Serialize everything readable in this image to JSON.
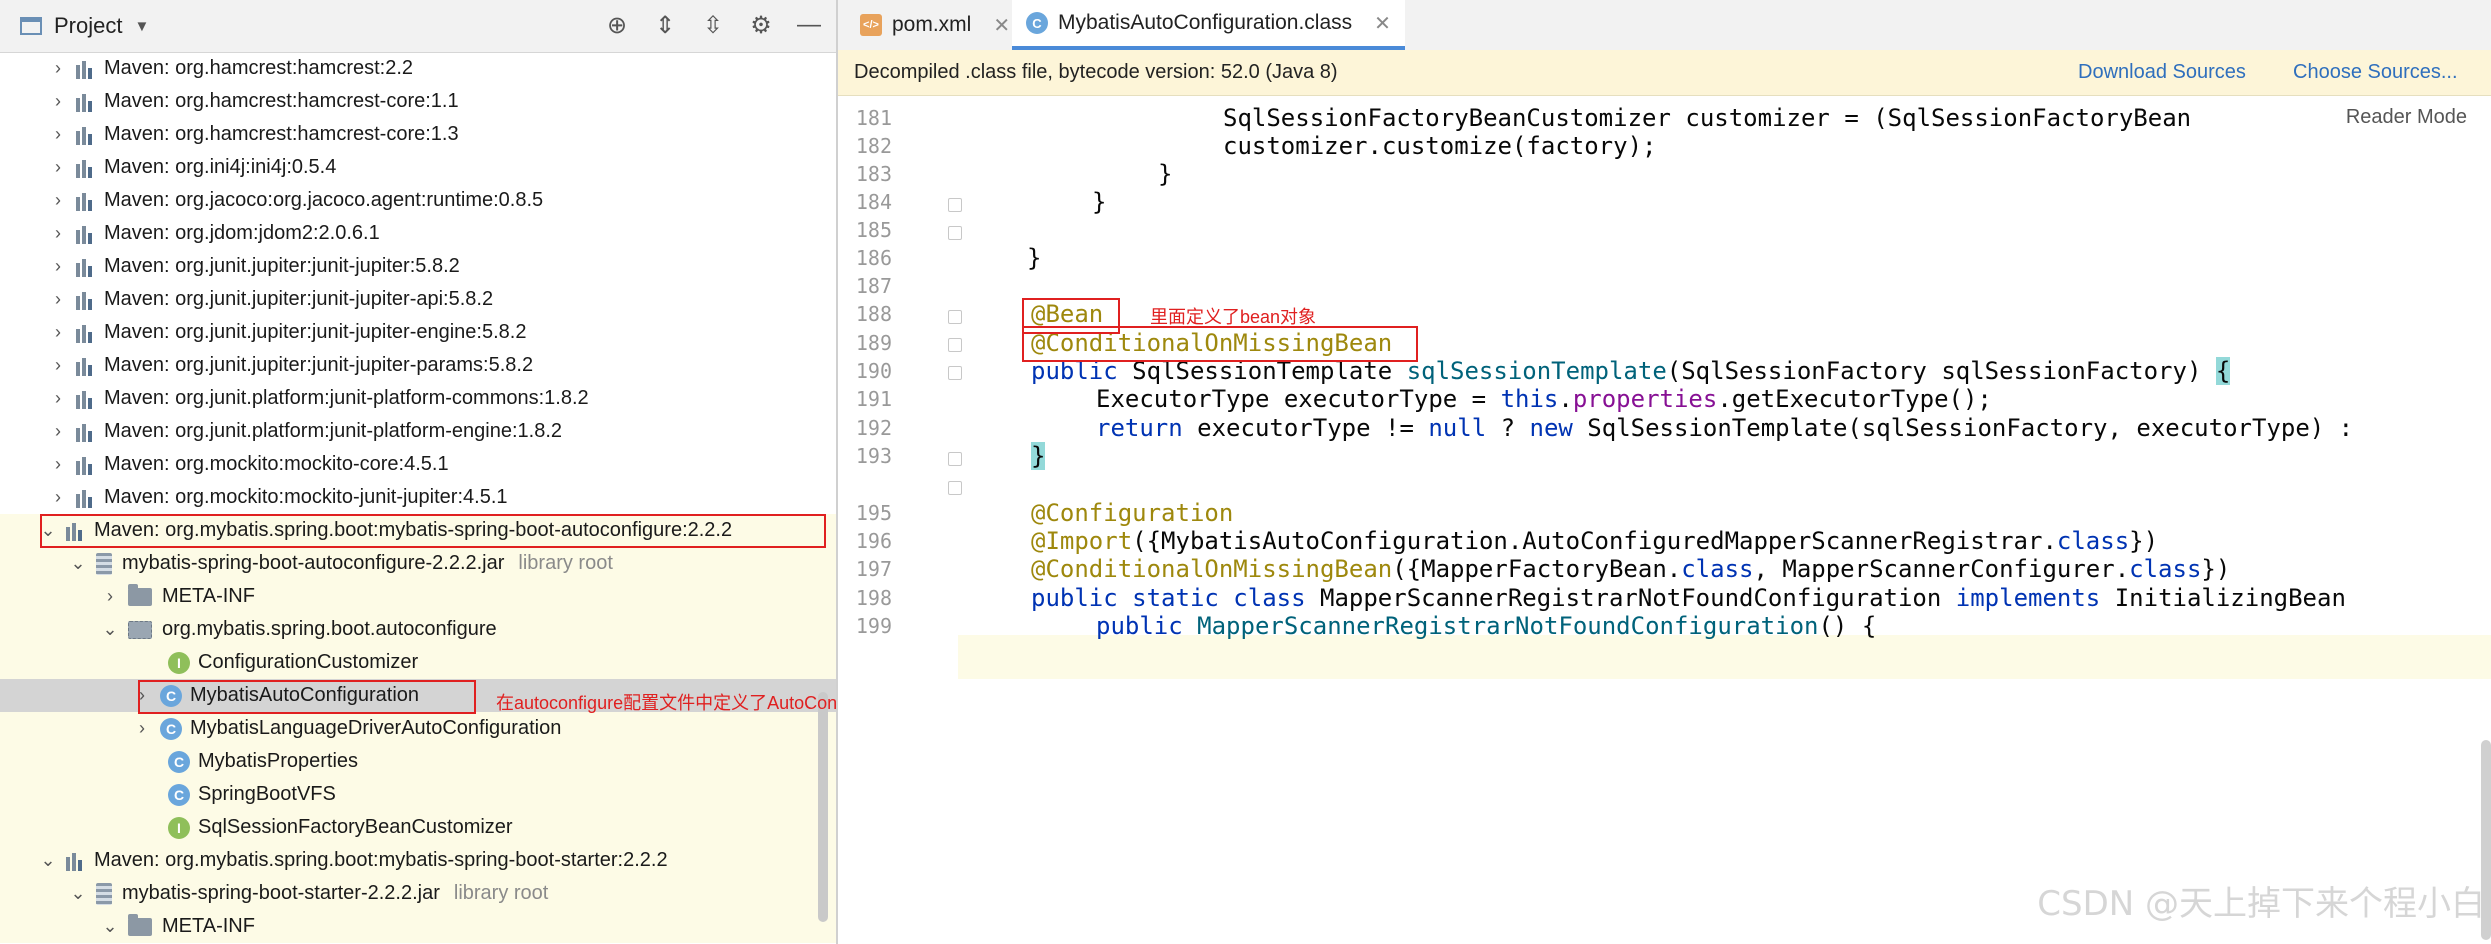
{
  "project": {
    "title": "Project",
    "tree": [
      {
        "label": "Maven: org.hamcrest:hamcrest:2.2"
      },
      {
        "label": "Maven: org.hamcrest:hamcrest-core:1.1"
      },
      {
        "label": "Maven: org.hamcrest:hamcrest-core:1.3"
      },
      {
        "label": "Maven: org.ini4j:ini4j:0.5.4"
      },
      {
        "label": "Maven: org.jacoco:org.jacoco.agent:runtime:0.8.5"
      },
      {
        "label": "Maven: org.jdom:jdom2:2.0.6.1"
      },
      {
        "label": "Maven: org.junit.jupiter:junit-jupiter:5.8.2"
      },
      {
        "label": "Maven: org.junit.jupiter:junit-jupiter-api:5.8.2"
      },
      {
        "label": "Maven: org.junit.jupiter:junit-jupiter-engine:5.8.2"
      },
      {
        "label": "Maven: org.junit.jupiter:junit-jupiter-params:5.8.2"
      },
      {
        "label": "Maven: org.junit.platform:junit-platform-commons:1.8.2"
      },
      {
        "label": "Maven: org.junit.platform:junit-platform-engine:1.8.2"
      },
      {
        "label": "Maven: org.mockito:mockito-core:4.5.1"
      },
      {
        "label": "Maven: org.mockito:mockito-junit-jupiter:4.5.1"
      },
      {
        "label": "Maven: org.mybatis.spring.boot:mybatis-spring-boot-autoconfigure:2.2.2"
      },
      {
        "label": "mybatis-spring-boot-autoconfigure-2.2.2.jar",
        "hint": "library root"
      },
      {
        "label": "META-INF"
      },
      {
        "label": "org.mybatis.spring.boot.autoconfigure"
      },
      {
        "label": "ConfigurationCustomizer"
      },
      {
        "label": "MybatisAutoConfiguration"
      },
      {
        "label": "MybatisLanguageDriverAutoConfiguration"
      },
      {
        "label": "MybatisProperties"
      },
      {
        "label": "SpringBootVFS"
      },
      {
        "label": "SqlSessionFactoryBeanCustomizer"
      },
      {
        "label": "Maven: org.mybatis.spring.boot:mybatis-spring-boot-starter:2.2.2"
      },
      {
        "label": "mybatis-spring-boot-starter-2.2.2.jar",
        "hint": "library root"
      },
      {
        "label": "META-INF"
      }
    ],
    "annotation": "在autoconfigure配置文件中定义了AutoConfiguration这个自动配置类"
  },
  "tabs": [
    {
      "label": "pom.xml",
      "icon": "xml-file-icon"
    },
    {
      "label": "MybatisAutoConfiguration.class",
      "icon": "class-file-icon"
    }
  ],
  "banner": {
    "message": "Decompiled .class file, bytecode version: 52.0 (Java 8)",
    "download_sources": "Download Sources",
    "choose_sources": "Choose Sources..."
  },
  "reader_mode": "Reader Mode",
  "code": {
    "line_numbers": [
      "181",
      "182",
      "183",
      "184",
      "185",
      "186",
      "187",
      "188",
      "189",
      "190",
      "191",
      "192",
      "193",
      "195",
      "196",
      "197",
      "198",
      "199"
    ],
    "bean_note": "里面定义了bean对象"
  },
  "watermark": "CSDN @天上掉下来个程小白",
  "colors": {
    "keyword": "#0033b3",
    "annotation": "#9e880d",
    "method": "#00627a",
    "field": "#871094",
    "highlight_box": "#e02020",
    "banner_bg": "#fdf5d8"
  }
}
